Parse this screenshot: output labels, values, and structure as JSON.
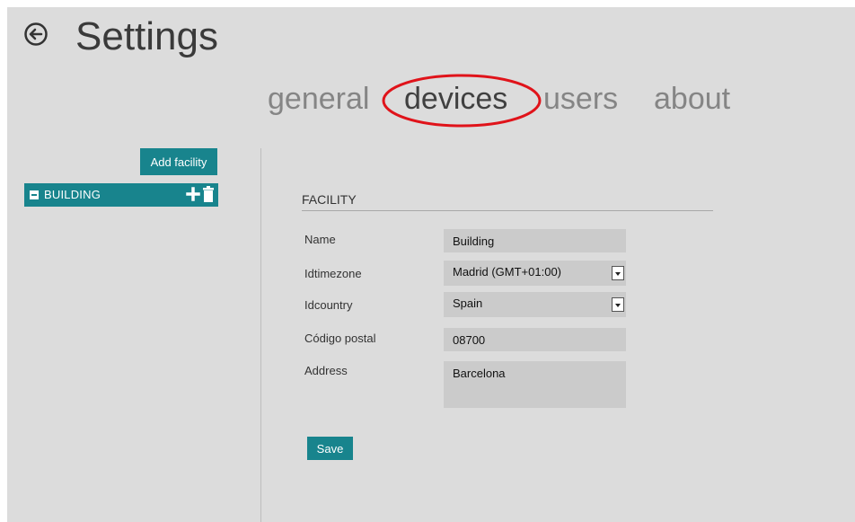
{
  "header": {
    "title": "Settings",
    "back_icon": "circle-arrow-left-icon"
  },
  "tabs": [
    {
      "label": "general",
      "active": false
    },
    {
      "label": "devices",
      "active": true
    },
    {
      "label": "users",
      "active": false
    },
    {
      "label": "about",
      "active": false
    }
  ],
  "sidebar": {
    "add_facility_label": "Add facility",
    "tree": [
      {
        "label": "BUILDING",
        "expanded": true,
        "icons": [
          "collapse-icon",
          "plus-icon",
          "trash-icon"
        ]
      }
    ]
  },
  "form": {
    "section_title": "FACILITY",
    "fields": [
      {
        "label": "Name",
        "value": "Building",
        "type": "text"
      },
      {
        "label": "Idtimezone",
        "value": "Madrid (GMT+01:00)",
        "type": "select"
      },
      {
        "label": "Idcountry",
        "value": "Spain",
        "type": "select"
      },
      {
        "label": "Código postal",
        "value": "08700",
        "type": "text"
      },
      {
        "label": "Address",
        "value": "Barcelona",
        "type": "textarea"
      }
    ],
    "save_label": "Save"
  },
  "colors": {
    "accent": "#18848d",
    "background": "#dcdcdc",
    "input_bg": "#cbcbcb",
    "highlight_ring": "#e0131a"
  }
}
